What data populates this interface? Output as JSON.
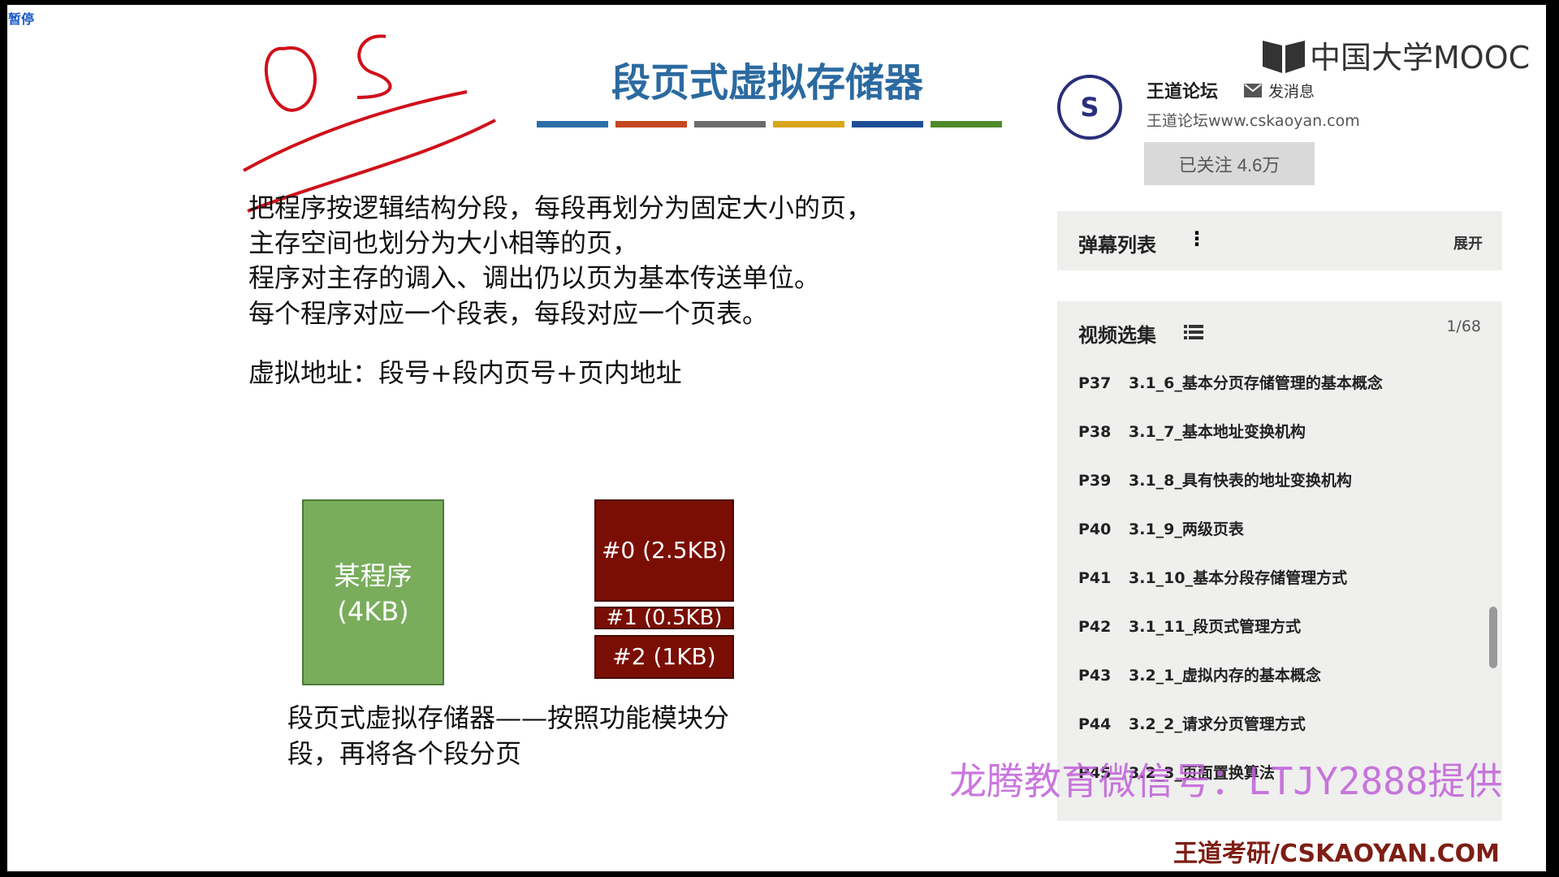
{
  "status": {
    "pause": "暂停"
  },
  "slide": {
    "title": "段页式虚拟存储器",
    "bar_colors": [
      "#2d6ea8",
      "#c4471e",
      "#6b6b6b",
      "#d9a51c",
      "#1f4e96",
      "#4d8a2a"
    ],
    "lines": [
      "把程序按逻辑结构分段，每段再划分为固定大小的页，",
      "主存空间也划分为大小相等的页，",
      "程序对主存的调入、调出仍以页为基本传送单位。",
      "每个程序对应一个段表，每段对应一个页表。"
    ],
    "address": "虚拟地址：段号+段内页号+页内地址",
    "program_label": "某程序",
    "program_size": "(4KB)",
    "segments": [
      "#0 (2.5KB)",
      "#1 (0.5KB)",
      "#2 (1KB)"
    ],
    "caption": [
      "段页式虚拟存储器——按照功能模块分",
      "段，再将各个段分页"
    ],
    "annotation": "OS"
  },
  "sidebar": {
    "logo": "中国大学MOOC",
    "author": "王道论坛",
    "message": "发消息",
    "url": "王道论坛www.cskaoyan.com",
    "follow": "已关注 4.6万",
    "danmaku_title": "弹幕列表",
    "expand": "展开",
    "playlist_title": "视频选集",
    "playlist_count": "1/68",
    "items": [
      {
        "p": "P37",
        "t": "3.1_6_基本分页存储管理的基本概念"
      },
      {
        "p": "P38",
        "t": "3.1_7_基本地址变换机构"
      },
      {
        "p": "P39",
        "t": "3.1_8_具有快表的地址变换机构"
      },
      {
        "p": "P40",
        "t": "3.1_9_两级页表"
      },
      {
        "p": "P41",
        "t": "3.1_10_基本分段存储管理方式"
      },
      {
        "p": "P42",
        "t": "3.1_11_段页式管理方式"
      },
      {
        "p": "P43",
        "t": "3.2_1_虚拟内存的基本概念"
      },
      {
        "p": "P44",
        "t": "3.2_2_请求分页管理方式"
      },
      {
        "p": "P45",
        "t": "3.2_3_页面置换算法"
      }
    ]
  },
  "watermark": "龙腾教育微信号：LTJY2888提供",
  "brand": "王道考研/CSKAOYAN.COM"
}
